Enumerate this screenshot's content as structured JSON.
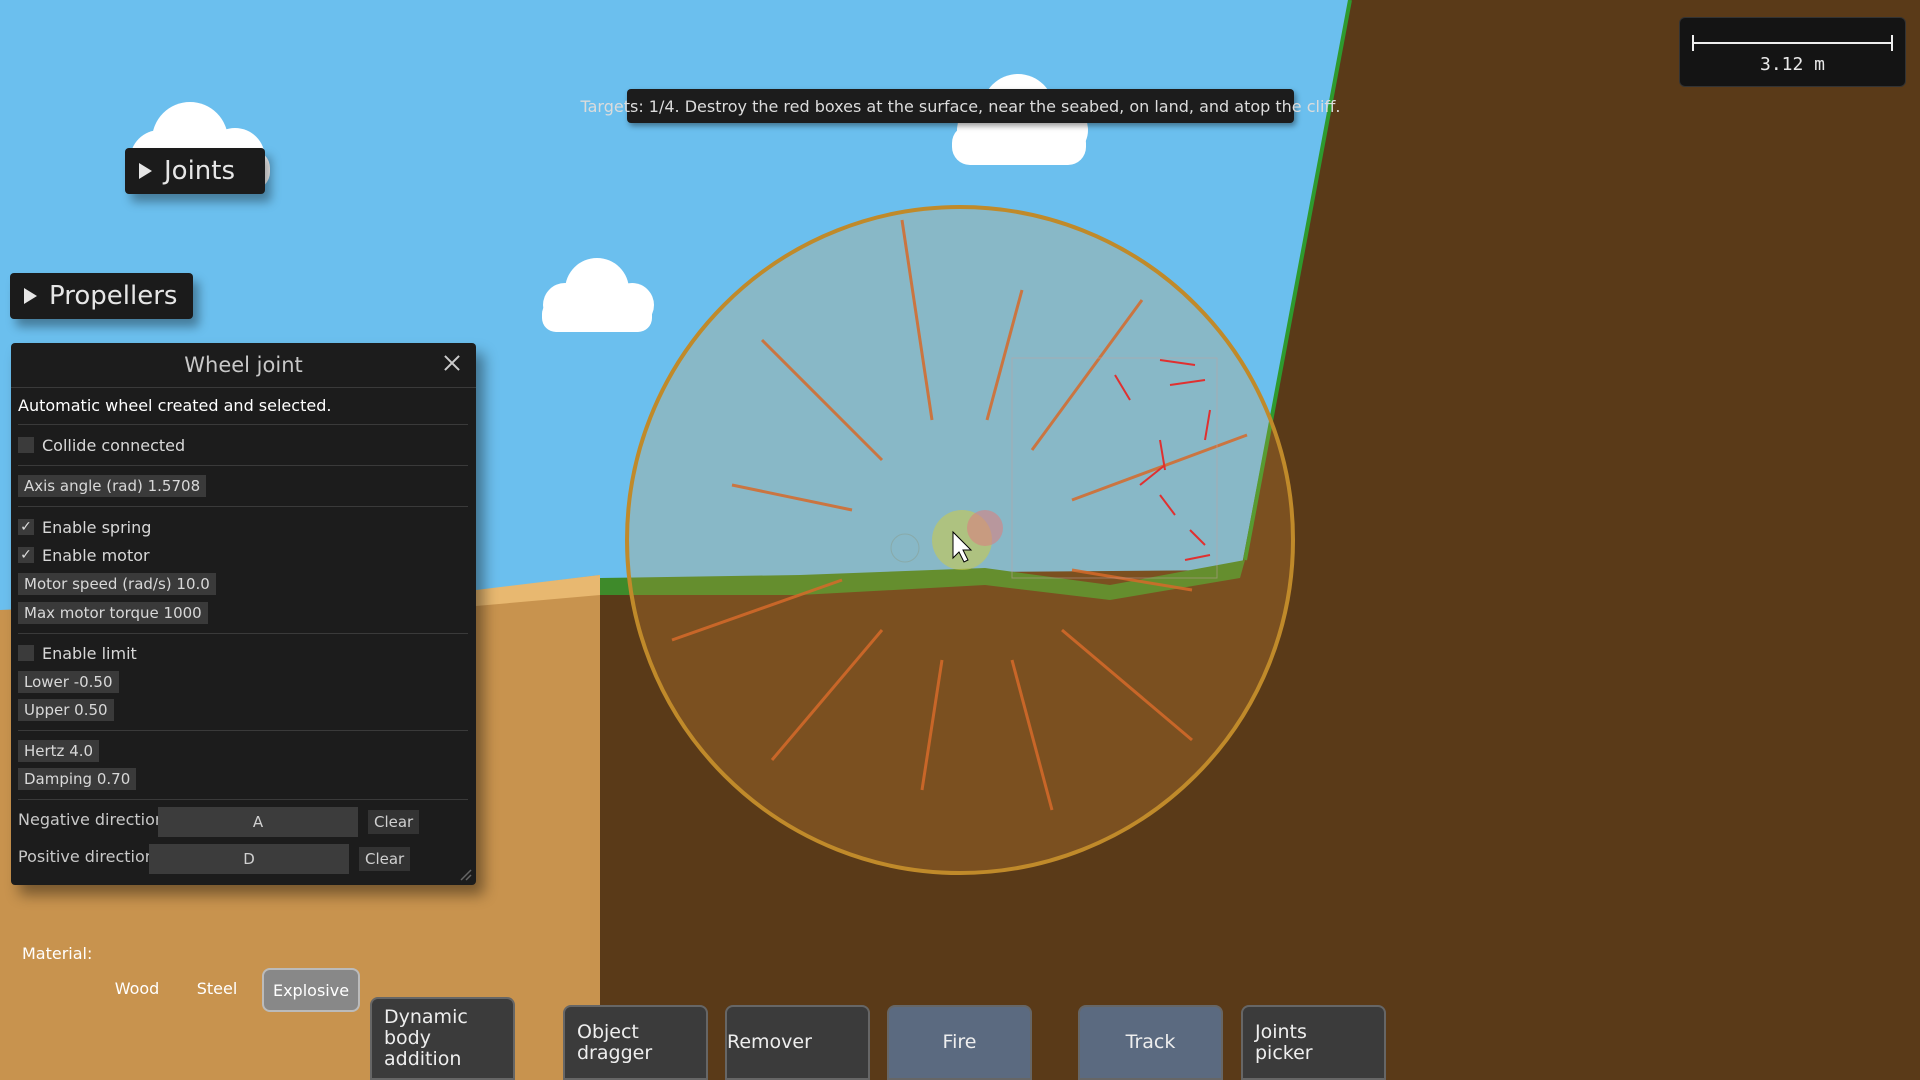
{
  "hud": {
    "joints_label": "Joints",
    "propellers_label": "Propellers",
    "targets_text": "Targets: 1/4. Destroy the red boxes at the surface, near the seabed, on land, and atop the cliff.",
    "scale_text": "3.12 m"
  },
  "wheel_joint": {
    "title": "Wheel joint",
    "status": "Automatic wheel created and selected.",
    "collide_connected": {
      "label": "Collide connected",
      "checked": false
    },
    "axis_angle": "Axis angle (rad) 1.5708",
    "enable_spring": {
      "label": "Enable spring",
      "checked": true
    },
    "enable_motor": {
      "label": "Enable motor",
      "checked": true
    },
    "motor_speed": "Motor speed (rad/s) 10.0",
    "max_motor_torque": "Max motor torque 1000",
    "enable_limit": {
      "label": "Enable limit",
      "checked": false
    },
    "lower": "Lower -0.50",
    "upper": "Upper 0.50",
    "hertz": "Hertz 4.0",
    "damping": "Damping 0.70",
    "negative_direction": {
      "label": "Negative direction",
      "key": "A",
      "clear": "Clear"
    },
    "positive_direction": {
      "label": "Positive direction",
      "key": "D",
      "clear": "Clear"
    },
    "check_glyph": "✓"
  },
  "material": {
    "label": "Material:",
    "options": [
      "Wood",
      "Steel",
      "Explosive"
    ],
    "selected": "Explosive"
  },
  "toolbar": {
    "dynamic_body_addition": "Dynamic body addition",
    "object_dragger": "Object dragger",
    "remover": "Remover",
    "fire": "Fire",
    "track": "Track",
    "joints_picker": "Joints picker"
  },
  "colors": {
    "sky": "#6bbfee",
    "sand": "#c8934e",
    "dirt": "#5a3a18",
    "grass": "#3e8a2a",
    "wheel_fill": "#8a4a1e",
    "wheel_rim": "#c08a2a"
  }
}
